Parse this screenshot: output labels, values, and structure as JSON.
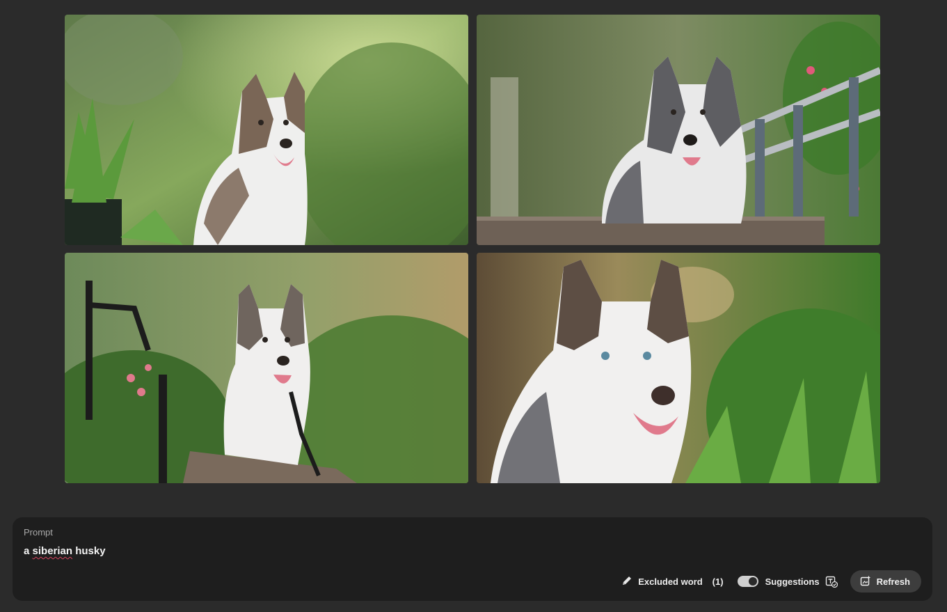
{
  "images": [
    {
      "name": "generated-image-1",
      "subject": "husky"
    },
    {
      "name": "generated-image-2",
      "subject": "husky"
    },
    {
      "name": "generated-image-3",
      "subject": "husky"
    },
    {
      "name": "generated-image-4",
      "subject": "husky"
    }
  ],
  "prompt": {
    "label": "Prompt",
    "text_prefix": "a ",
    "text_misspelled": "siberian",
    "text_suffix": " husky"
  },
  "controls": {
    "excluded_label": "Excluded word",
    "excluded_count": "(1)",
    "suggestions_label": "Suggestions",
    "suggestions_on": true,
    "refresh_label": "Refresh"
  },
  "icons": {
    "excluded": "pencil-icon",
    "suggestions": "text-check-icon",
    "refresh": "refresh-image-icon"
  }
}
